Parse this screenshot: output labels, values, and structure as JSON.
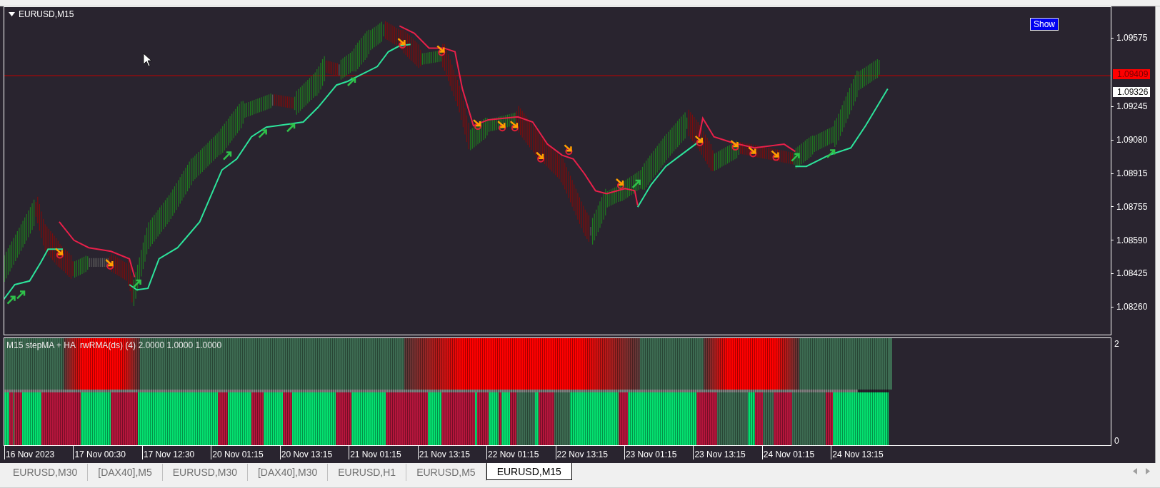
{
  "chart_window": {
    "title": "EURUSD,M15",
    "show_button": "Show",
    "price_axis": [
      "1.09575",
      "1.09245",
      "1.09080",
      "1.08915",
      "1.08755",
      "1.08590",
      "1.08425",
      "1.08260"
    ],
    "price_tags": [
      {
        "label": "1.09409",
        "kind": "bid"
      },
      {
        "label": "1.09326",
        "kind": "level"
      }
    ],
    "indicator": {
      "label": "M15 stepMA + HA  rwRMA(ds) (4) 2.0000 1.0000 1.0000",
      "axis": [
        "2",
        "0"
      ]
    },
    "time_axis": [
      "16 Nov 2023",
      "17 Nov 00:30",
      "17 Nov 12:30",
      "20 Nov 01:15",
      "20 Nov 13:15",
      "21 Nov 01:15",
      "21 Nov 13:15",
      "22 Nov 01:15",
      "22 Nov 13:15",
      "23 Nov 01:15",
      "23 Nov 13:15",
      "24 Nov 01:15",
      "24 Nov 13:15"
    ]
  },
  "tabs": [
    {
      "label": "EURUSD,M30",
      "selected": false
    },
    {
      "label": "[DAX40],M5",
      "selected": false
    },
    {
      "label": "EURUSD,M30",
      "selected": false
    },
    {
      "label": "[DAX40],M30",
      "selected": false
    },
    {
      "label": "EURUSD,H1",
      "selected": false
    },
    {
      "label": "EURUSD,M5",
      "selected": false
    },
    {
      "label": "EURUSD,M15",
      "selected": true
    }
  ]
}
